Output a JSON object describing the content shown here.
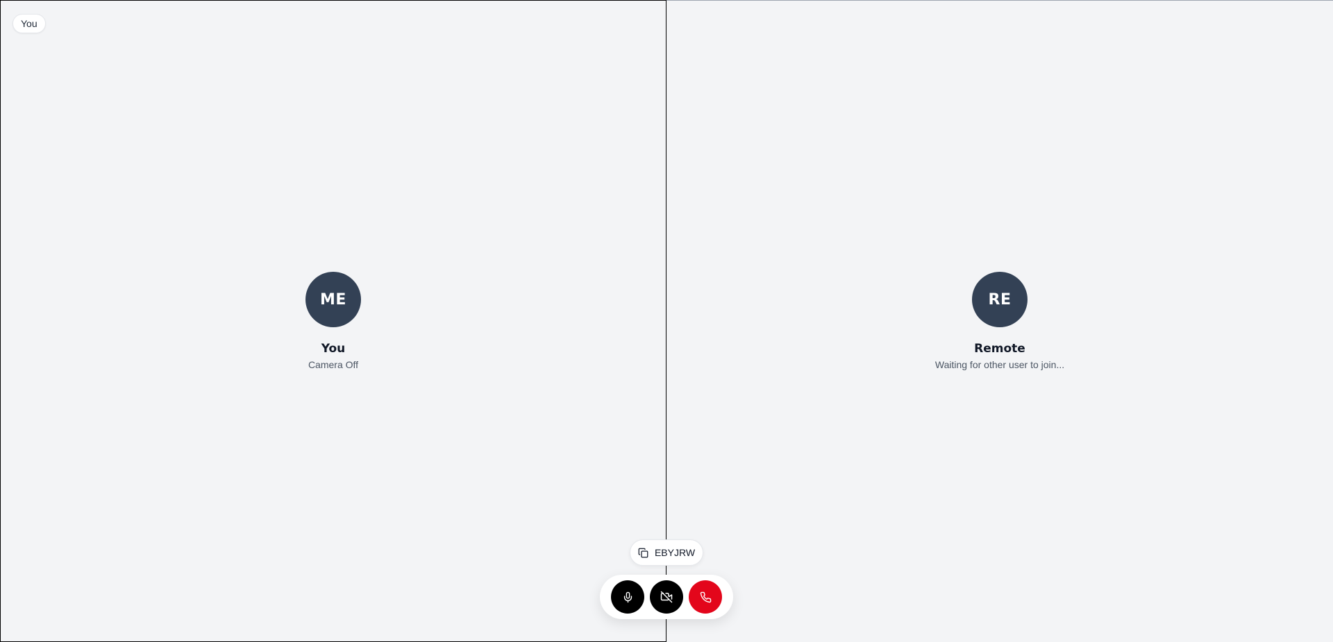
{
  "local": {
    "chip_label": "You",
    "initials": "ME",
    "name": "You",
    "status": "Camera Off"
  },
  "remote": {
    "initials": "RE",
    "name": "Remote",
    "status": "Waiting for other user to join..."
  },
  "room": {
    "code": "EBYJRW",
    "icon": "copy-icon"
  },
  "controls": {
    "mic_icon": "microphone-icon",
    "camera_icon": "camera-off-icon",
    "end_icon": "phone-hangup-icon",
    "end_color": "#e3061b",
    "button_color": "#000000"
  },
  "colors": {
    "background": "#f3f4f6",
    "avatar": "#334155"
  }
}
